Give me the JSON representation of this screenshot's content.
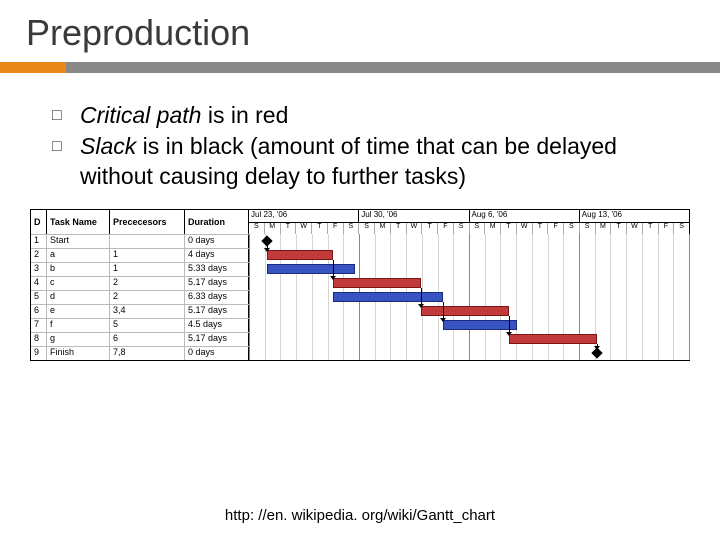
{
  "title": "Preproduction",
  "bullets": [
    {
      "prefix_italic": "Critical path",
      "rest": " is in red"
    },
    {
      "prefix_italic": "Slack",
      "rest": " is in black (amount of time that can be delayed without causing delay to further tasks)"
    }
  ],
  "chart_data": {
    "type": "gantt",
    "columns": {
      "D": "D",
      "task": "Task Name",
      "pred": "Prececesors",
      "dur": "Duration"
    },
    "weeks": [
      "Jul 23, '06",
      "Jul 30, '06",
      "Aug 6, '06",
      "Aug 13, '06"
    ],
    "days": [
      "S",
      "M",
      "T",
      "W",
      "T",
      "F",
      "S"
    ],
    "tasks": [
      {
        "id": "1",
        "name": "Start",
        "pred": "",
        "dur": "0 days",
        "kind": "milestone",
        "pos": 0.04
      },
      {
        "id": "2",
        "name": "a",
        "pred": "1",
        "dur": "4 days",
        "kind": "red",
        "start": 0.04,
        "end": 0.19
      },
      {
        "id": "3",
        "name": "b",
        "pred": "1",
        "dur": "5.33 days",
        "kind": "blue",
        "start": 0.04,
        "end": 0.24
      },
      {
        "id": "4",
        "name": "c",
        "pred": "2",
        "dur": "5.17 days",
        "kind": "red",
        "start": 0.19,
        "end": 0.39
      },
      {
        "id": "5",
        "name": "d",
        "pred": "2",
        "dur": "6.33 days",
        "kind": "blue",
        "start": 0.19,
        "end": 0.44
      },
      {
        "id": "6",
        "name": "e",
        "pred": "3,4",
        "dur": "5.17 days",
        "kind": "red",
        "start": 0.39,
        "end": 0.59
      },
      {
        "id": "7",
        "name": "f",
        "pred": "5",
        "dur": "4.5 days",
        "kind": "blue",
        "start": 0.44,
        "end": 0.61
      },
      {
        "id": "8",
        "name": "g",
        "pred": "6",
        "dur": "5.17 days",
        "kind": "red",
        "start": 0.59,
        "end": 0.79
      },
      {
        "id": "9",
        "name": "Finish",
        "pred": "7,8",
        "dur": "0 days",
        "kind": "milestone",
        "pos": 0.79
      }
    ]
  },
  "footer": "http: //en. wikipedia. org/wiki/Gantt_chart"
}
